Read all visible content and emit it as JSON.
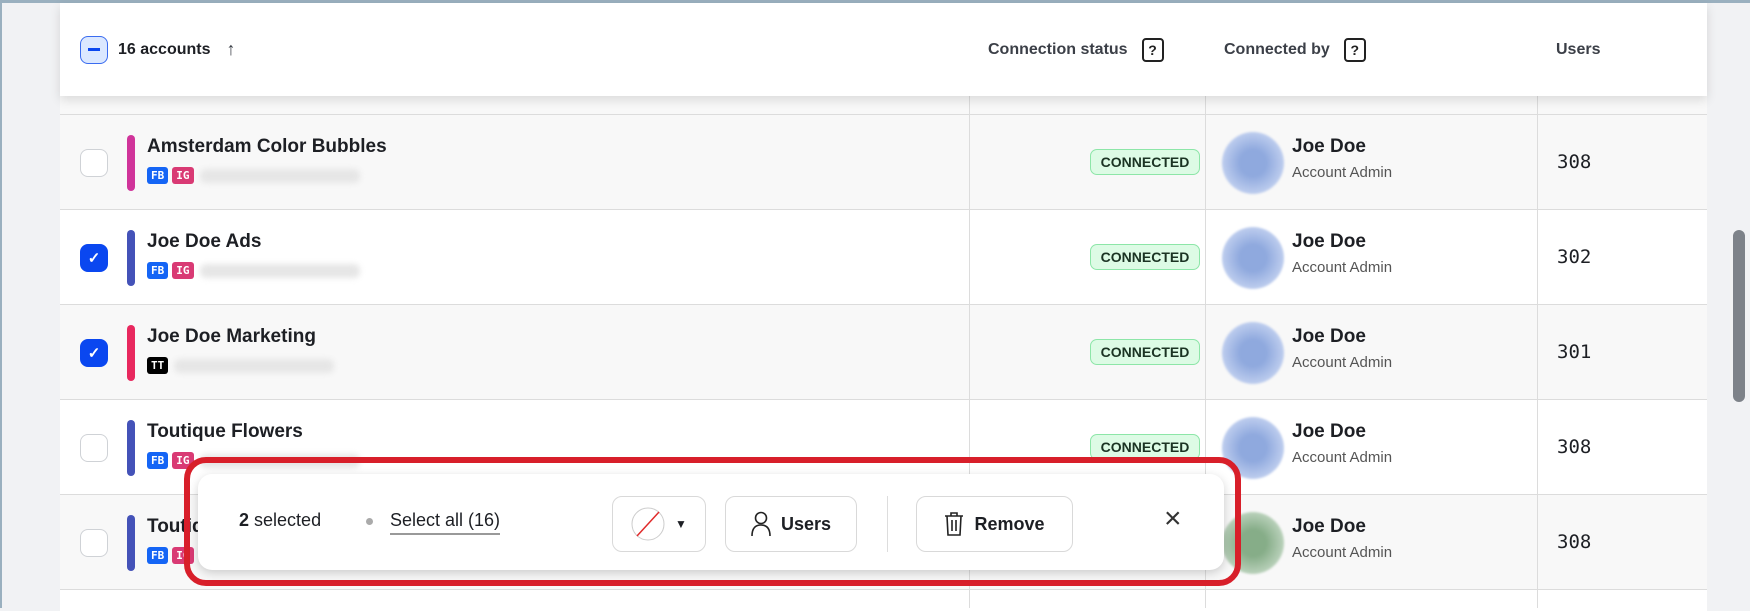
{
  "header": {
    "count_label": "16 accounts",
    "sort_icon": "arrow-up-icon",
    "columns": [
      "Connection status",
      "Connected by",
      "Users"
    ],
    "help": "?"
  },
  "rows": [
    {
      "name": "Amsterdam Color Bubbles",
      "color": "#d0349a",
      "tags": [
        "FB",
        "IG"
      ],
      "status": "CONNECTED",
      "by": "Joe Doe",
      "role": "Account Admin",
      "users": "308",
      "checked": false
    },
    {
      "name": "Joe Doe Ads",
      "color": "#4452b8",
      "tags": [
        "FB",
        "IG"
      ],
      "status": "CONNECTED",
      "by": "Joe Doe",
      "role": "Account Admin",
      "users": "302",
      "checked": true
    },
    {
      "name": "Joe Doe Marketing",
      "color": "#e8285e",
      "tags": [
        "TT"
      ],
      "status": "CONNECTED",
      "by": "Joe Doe",
      "role": "Account Admin",
      "users": "301",
      "checked": true
    },
    {
      "name": "Toutique Flowers",
      "color": "#4452b8",
      "tags": [
        "FB",
        "IG"
      ],
      "status": "CONNECTED",
      "by": "Joe Doe",
      "role": "Account Admin",
      "users": "308",
      "checked": false
    },
    {
      "name": "Toutique",
      "color": "#4452b8",
      "tags": [
        "FB",
        "IG"
      ],
      "status": "",
      "by": "Joe Doe",
      "role": "Account Admin",
      "users": "308",
      "checked": false
    }
  ],
  "tag_colors": {
    "FB": "#1565f5",
    "IG": "#d93a74",
    "TT": "#000000"
  },
  "bulk": {
    "count": "2",
    "selected_label": "selected",
    "select_all": "Select all (16)",
    "users_label": "Users",
    "remove_label": "Remove",
    "close": "×"
  }
}
